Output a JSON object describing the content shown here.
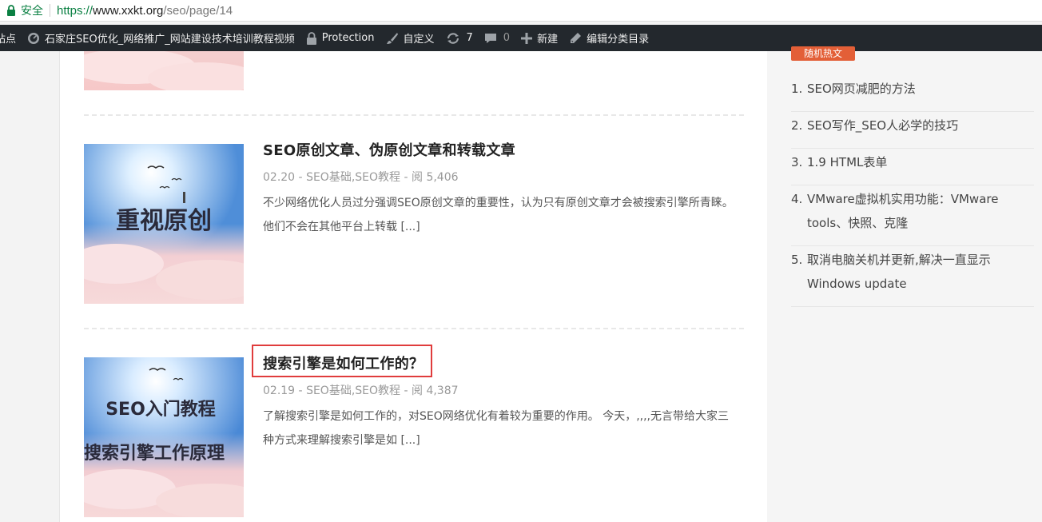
{
  "browser": {
    "secure_label": "安全",
    "url_scheme": "https://",
    "url_host": "www.xxkt.org",
    "url_path": "/seo/page/14"
  },
  "adminbar": {
    "items": [
      {
        "label": "站点",
        "icon": "wordpress-icon"
      },
      {
        "label": "石家庄SEO优化_网络推广_网站建设技术培训教程视频",
        "icon": "dashboard-icon"
      },
      {
        "label": "Protection",
        "icon": "lock-icon"
      },
      {
        "label": "自定义",
        "icon": "brush-icon"
      },
      {
        "label": "",
        "count": "7",
        "icon": "updates-icon"
      },
      {
        "label": "",
        "count": "0",
        "icon": "comment-icon"
      },
      {
        "label": "新建",
        "icon": "plus-icon"
      },
      {
        "label": "编辑分类目录",
        "icon": "pencil-icon"
      }
    ]
  },
  "posts": [
    {
      "thumb_text": "",
      "title": "",
      "meta": ""
    },
    {
      "thumb_text": "重视原创",
      "title": "SEO原创文章、伪原创文章和转载文章",
      "date": "02.20",
      "categories": "SEO基础,SEO教程",
      "views": "阅 5,406",
      "excerpt": "不少网络优化人员过分强调SEO原创文章的重要性，认为只有原创文章才会被搜索引擎所青睐。他们不会在其他平台上转载 [...]"
    },
    {
      "thumb_text_1": "SEO入门教程",
      "thumb_text_2": "搜索引擎工作原理",
      "title": "搜索引擎是如何工作的？",
      "date": "02.19",
      "categories": "SEO基础,SEO教程",
      "views": "阅 4,387",
      "excerpt": "了解搜索引擎是如何工作的，对SEO网络优化有着较为重要的作用。 今天，,,,,无言带给大家三种方式来理解搜索引擎是如 [...]"
    }
  ],
  "sidebar": {
    "badge": "随机热文",
    "popular": [
      {
        "num": "1.",
        "title": "SEO网页减肥的方法"
      },
      {
        "num": "2.",
        "title": "SEO写作_SEO人必学的技巧"
      },
      {
        "num": "3.",
        "title": "1.9 HTML表单"
      },
      {
        "num": "4.",
        "title": "VMware虚拟机实用功能：VMware tools、快照、克隆"
      },
      {
        "num": "5.",
        "title": "取消电脑关机并更新,解决一直显示Windows update"
      }
    ]
  },
  "colors": {
    "accent": "#e35f37",
    "highlight_border": "#e03c3c",
    "secure_green": "#0b8043",
    "adminbar_bg": "#23282d"
  }
}
